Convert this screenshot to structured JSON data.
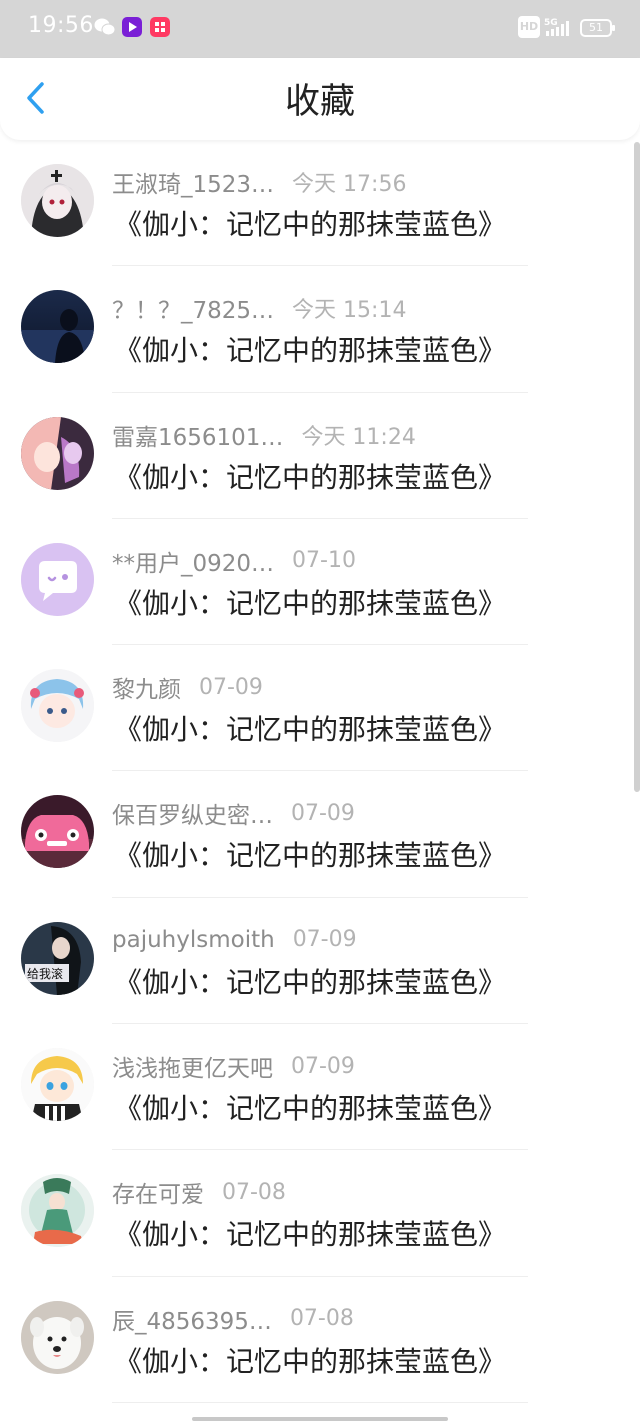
{
  "status_bar": {
    "time": "19:56",
    "hd_badge": "HD",
    "signal_label": "5G",
    "battery_level": "51"
  },
  "header": {
    "title": "收藏",
    "back_icon": "chevron-left-icon",
    "accent_color": "#2fa0f0"
  },
  "items": [
    {
      "username": "王淑琦_1523…",
      "time": "今天 17:56",
      "title": "《伽小：记忆中的那抹莹蓝色》",
      "avatar": "anime-girl-dark"
    },
    {
      "username": "？！？_7825…",
      "time": "今天 15:14",
      "title": "《伽小：记忆中的那抹莹蓝色》",
      "avatar": "night-silhouette"
    },
    {
      "username": "雷嘉1656101…",
      "time": "今天 11:24",
      "title": "《伽小：记忆中的那抹莹蓝色》",
      "avatar": "anime-pink"
    },
    {
      "username": "**用户_0920…",
      "time": "07-10",
      "title": "《伽小：记忆中的那抹莹蓝色》",
      "avatar": "default-chat"
    },
    {
      "username": "黎九颜",
      "time": "07-09",
      "title": "《伽小：记忆中的那抹莹蓝色》",
      "avatar": "anime-blue-hair"
    },
    {
      "username": "保百罗纵史密…",
      "time": "07-09",
      "title": "《伽小：记忆中的那抹莹蓝色》",
      "avatar": "pink-car"
    },
    {
      "username": "pajuhylsmoith",
      "time": "07-09",
      "title": "《伽小：记忆中的那抹莹蓝色》",
      "avatar": "dark-meme",
      "avatar_text": "给我滚"
    },
    {
      "username": "浅浅拖更亿天吧",
      "time": "07-09",
      "title": "《伽小：记忆中的那抹莹蓝色》",
      "avatar": "anime-blonde"
    },
    {
      "username": "存在可爱",
      "time": "07-08",
      "title": "《伽小：记忆中的那抹莹蓝色》",
      "avatar": "mermaid-art"
    },
    {
      "username": "辰_4856395…",
      "time": "07-08",
      "title": "《伽小：记忆中的那抹莹蓝色》",
      "avatar": "white-dog"
    }
  ]
}
